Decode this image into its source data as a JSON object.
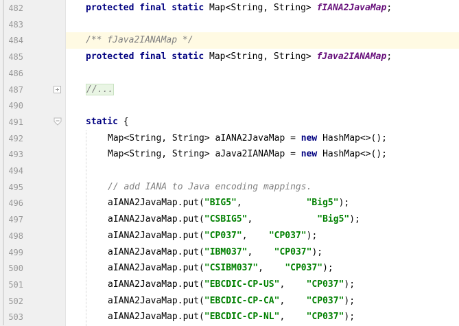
{
  "editor": {
    "lines": [
      {
        "num": "482",
        "indent": 0,
        "tokens": [
          {
            "c": "kw",
            "t": "protected final static"
          },
          {
            "c": "",
            "t": " Map<String, String> "
          },
          {
            "c": "field",
            "t": "fIANA2JavaMap"
          },
          {
            "c": "",
            "t": ";"
          }
        ]
      },
      {
        "num": "483",
        "indent": 0,
        "tokens": []
      },
      {
        "num": "484",
        "indent": 0,
        "hl": true,
        "tokens": [
          {
            "c": "cmt",
            "t": "/** fJava2IANAMap */"
          }
        ]
      },
      {
        "num": "485",
        "indent": 0,
        "tokens": [
          {
            "c": "kw",
            "t": "protected final static"
          },
          {
            "c": "",
            "t": " Map<String, String> "
          },
          {
            "c": "field",
            "t": "fJava2IANAMap"
          },
          {
            "c": "",
            "t": ";"
          }
        ]
      },
      {
        "num": "486",
        "indent": 0,
        "tokens": []
      },
      {
        "num": "487",
        "indent": 0,
        "fold": "plus",
        "tokens": [
          {
            "c": "cmt collapsed",
            "t": "//..."
          }
        ]
      },
      {
        "num": "490",
        "indent": 0,
        "tokens": []
      },
      {
        "num": "491",
        "indent": 0,
        "fold": "minus",
        "tokens": [
          {
            "c": "kw",
            "t": "static"
          },
          {
            "c": "",
            "t": " {"
          }
        ]
      },
      {
        "num": "492",
        "indent": 1,
        "tokens": [
          {
            "c": "",
            "t": "Map<String, String> aIANA2JavaMap = "
          },
          {
            "c": "kw",
            "t": "new"
          },
          {
            "c": "",
            "t": " HashMap<>();"
          }
        ]
      },
      {
        "num": "493",
        "indent": 1,
        "tokens": [
          {
            "c": "",
            "t": "Map<String, String> aJava2IANAMap = "
          },
          {
            "c": "kw",
            "t": "new"
          },
          {
            "c": "",
            "t": " HashMap<>();"
          }
        ]
      },
      {
        "num": "494",
        "indent": 0,
        "tokens": []
      },
      {
        "num": "495",
        "indent": 1,
        "tokens": [
          {
            "c": "cmt",
            "t": "// add IANA to Java encoding mappings."
          }
        ]
      },
      {
        "num": "496",
        "indent": 1,
        "tokens": [
          {
            "c": "",
            "t": "aIANA2JavaMap.put("
          },
          {
            "c": "str",
            "t": "\"BIG5\""
          },
          {
            "c": "",
            "t": ",            "
          },
          {
            "c": "str",
            "t": "\"Big5\""
          },
          {
            "c": "",
            "t": ");"
          }
        ]
      },
      {
        "num": "497",
        "indent": 1,
        "tokens": [
          {
            "c": "",
            "t": "aIANA2JavaMap.put("
          },
          {
            "c": "str",
            "t": "\"CSBIG5\""
          },
          {
            "c": "",
            "t": ",            "
          },
          {
            "c": "str",
            "t": "\"Big5\""
          },
          {
            "c": "",
            "t": ");"
          }
        ]
      },
      {
        "num": "498",
        "indent": 1,
        "tokens": [
          {
            "c": "",
            "t": "aIANA2JavaMap.put("
          },
          {
            "c": "str",
            "t": "\"CP037\""
          },
          {
            "c": "",
            "t": ",    "
          },
          {
            "c": "str",
            "t": "\"CP037\""
          },
          {
            "c": "",
            "t": ");"
          }
        ]
      },
      {
        "num": "499",
        "indent": 1,
        "tokens": [
          {
            "c": "",
            "t": "aIANA2JavaMap.put("
          },
          {
            "c": "str",
            "t": "\"IBM037\""
          },
          {
            "c": "",
            "t": ",    "
          },
          {
            "c": "str",
            "t": "\"CP037\""
          },
          {
            "c": "",
            "t": ");"
          }
        ]
      },
      {
        "num": "500",
        "indent": 1,
        "tokens": [
          {
            "c": "",
            "t": "aIANA2JavaMap.put("
          },
          {
            "c": "str",
            "t": "\"CSIBM037\""
          },
          {
            "c": "",
            "t": ",    "
          },
          {
            "c": "str",
            "t": "\"CP037\""
          },
          {
            "c": "",
            "t": ");"
          }
        ]
      },
      {
        "num": "501",
        "indent": 1,
        "tokens": [
          {
            "c": "",
            "t": "aIANA2JavaMap.put("
          },
          {
            "c": "str",
            "t": "\"EBCDIC-CP-US\""
          },
          {
            "c": "",
            "t": ",    "
          },
          {
            "c": "str",
            "t": "\"CP037\""
          },
          {
            "c": "",
            "t": ");"
          }
        ]
      },
      {
        "num": "502",
        "indent": 1,
        "tokens": [
          {
            "c": "",
            "t": "aIANA2JavaMap.put("
          },
          {
            "c": "str",
            "t": "\"EBCDIC-CP-CA\""
          },
          {
            "c": "",
            "t": ",    "
          },
          {
            "c": "str",
            "t": "\"CP037\""
          },
          {
            "c": "",
            "t": ");"
          }
        ]
      },
      {
        "num": "503",
        "indent": 1,
        "tokens": [
          {
            "c": "",
            "t": "aIANA2JavaMap.put("
          },
          {
            "c": "str",
            "t": "\"EBCDIC-CP-NL\""
          },
          {
            "c": "",
            "t": ",    "
          },
          {
            "c": "str",
            "t": "\"CP037\""
          },
          {
            "c": "",
            "t": ");"
          }
        ]
      }
    ]
  },
  "colors": {
    "keyword": "#000080",
    "static_field": "#660e7a",
    "string": "#008000",
    "comment": "#808080",
    "current_line": "#fffae3",
    "gutter": "#f0f0f0"
  }
}
